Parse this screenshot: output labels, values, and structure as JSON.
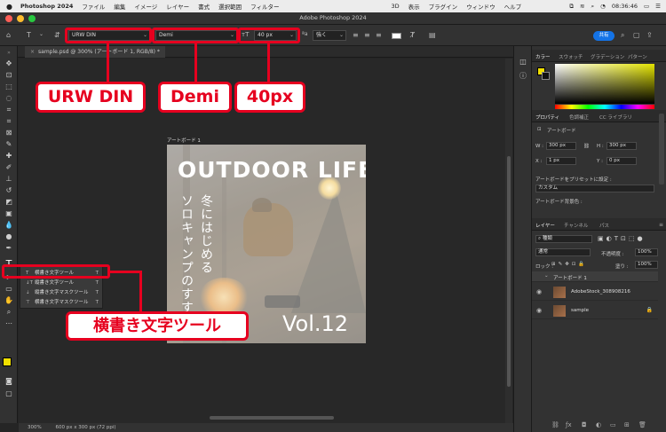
{
  "menubar": {
    "app_name": "Photoshop 2024",
    "items": [
      "ファイル",
      "編集",
      "イメージ",
      "レイヤー",
      "書式",
      "選択範囲",
      "フィルター",
      "3D",
      "表示",
      "プラグイン",
      "ウィンドウ",
      "ヘルプ"
    ],
    "time": "08:36:46"
  },
  "window": {
    "title": "Adobe Photoshop 2024"
  },
  "options": {
    "font_family": "URW DIN",
    "font_style": "Demi",
    "font_size": "40 px",
    "aa_label": "ªa",
    "aa_mode": "強く",
    "share_label": "共有"
  },
  "document": {
    "tab_label": "sample.psd @ 300% (アートボード 1, RGB/8) *",
    "artboard_name": "アートボード 1",
    "headline": "OUTDOOR LIFE",
    "vertical_line1": "冬にはじめる",
    "vertical_line2": "ソロキャンプのすすめ",
    "issue": "Vol.12"
  },
  "flyout": {
    "items": [
      {
        "label": "横書き文字ツール",
        "key": "T"
      },
      {
        "label": "縦書き文字ツール",
        "key": "T"
      },
      {
        "label": "縦書き文字マスクツール",
        "key": "T"
      },
      {
        "label": "横書き文字マスクツール",
        "key": "T"
      }
    ]
  },
  "callouts": {
    "font": "URW DIN",
    "style": "Demi",
    "size": "40px",
    "tool": "横書き文字ツール"
  },
  "status": {
    "zoom": "300%",
    "doc_size": "600 px x 300 px (72 ppi)"
  },
  "panels": {
    "color_tabs": [
      "カラー",
      "スウォッチ",
      "グラデーション",
      "パターン"
    ],
    "props_tabs": [
      "プロパティ",
      "色調補正",
      "CC ライブラリ"
    ],
    "artboard_label": "アートボード",
    "w_label": "W :",
    "w_value": "300 px",
    "h_label": "H :",
    "h_value": "300 px",
    "x_label": "X :",
    "x_value": "1 px",
    "y_label": "Y :",
    "y_value": "0 px",
    "preset_label": "アートボードをプリセットに設定 :",
    "preset_value": "カスタム",
    "bg_label": "アートボード背景色 :",
    "layer_tabs": [
      "レイヤー",
      "チャンネル",
      "パス"
    ],
    "kind_filter": "種類",
    "blend_mode": "通常",
    "opacity_label": "不透明度 :",
    "opacity_value": "100%",
    "lock_label": "ロック :",
    "fill_label": "塗り :",
    "fill_value": "100%",
    "layers": [
      {
        "name": "アートボード 1"
      },
      {
        "name": "AdobeStock_308908216"
      },
      {
        "name": "sample"
      }
    ]
  },
  "colors": {
    "accent_red": "#e6001f",
    "share_blue": "#1473e6",
    "foreground": "#f2e000"
  }
}
